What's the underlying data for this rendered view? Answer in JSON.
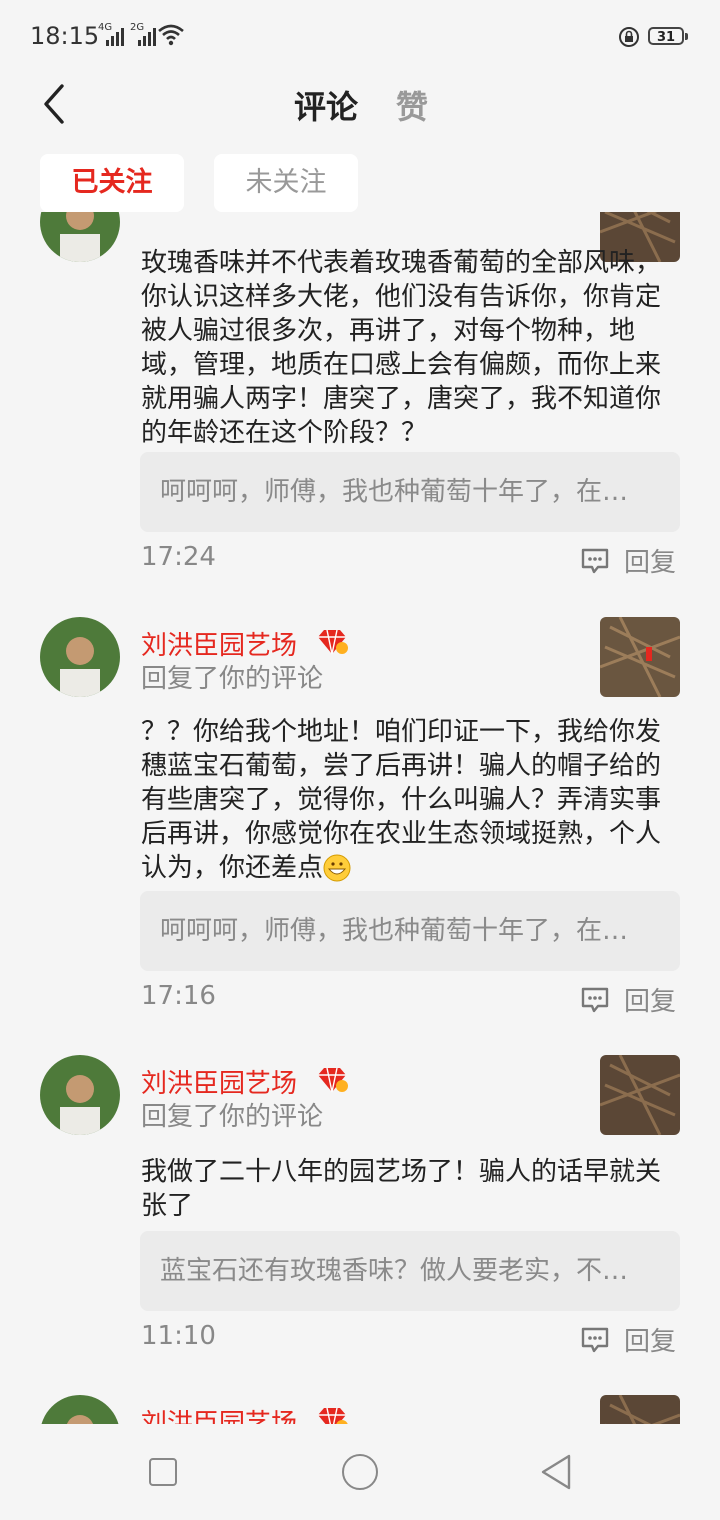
{
  "status_bar": {
    "time": "18:15",
    "signal_1_label": "4G",
    "signal_2_label": "2G",
    "battery": "31"
  },
  "header": {
    "back_icon": "chevron-left-icon",
    "tab_comments": "评论",
    "tab_likes": "赞"
  },
  "filters": {
    "followed": "已关注",
    "unfollowed": "未关注"
  },
  "accent_color": "#e5281f",
  "comments": [
    {
      "text": "玫瑰香味并不代表着玫瑰香葡萄的全部风味，你认识这样多大佬，他们没有告诉你，你肯定被人骗过很多次，再讲了，对每个物种，地域，管理，地质在口感上会有偏颇，而你上来就用骗人两字！唐突了，唐突了，我不知道你的年龄还在这个阶段？？",
      "quote": "呵呵呵，师傅，我也种葡萄十年了，在…",
      "time": "17:24",
      "reply": "回复"
    },
    {
      "user": "刘洪臣园艺场",
      "action": "回复了你的评论",
      "text": "？？你给我个地址！咱们印证一下，我给你发穗蓝宝石葡萄，尝了后再讲！骗人的帽子给的有些唐突了，觉得你，什么叫骗人？弄清实事后再讲，你感觉你在农业生态领域挺熟，个人认为，你还差点",
      "quote": "呵呵呵，师傅，我也种葡萄十年了，在…",
      "time": "17:16",
      "reply": "回复"
    },
    {
      "user": "刘洪臣园艺场",
      "action": "回复了你的评论",
      "text": "我做了二十八年的园艺场了！骗人的话早就关张了",
      "quote": "蓝宝石还有玫瑰香味？做人要老实，不…",
      "time": "11:10",
      "reply": "回复"
    },
    {
      "user": "刘洪臣园艺场"
    }
  ]
}
